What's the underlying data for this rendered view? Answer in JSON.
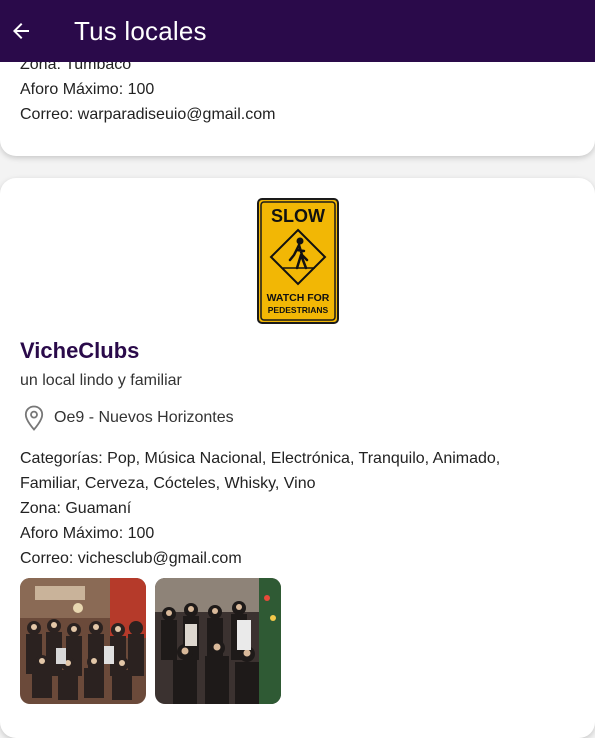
{
  "appbar": {
    "title": "Tus locales"
  },
  "previous_card": {
    "zona_line": "Zona: Tumbaco",
    "aforo_line": "Aforo Máximo: 100",
    "correo_line": "Correo: warparadiseuio@gmail.com"
  },
  "venue": {
    "logo": {
      "top_text": "SLOW",
      "bottom_text_1": "WATCH FOR",
      "bottom_text_2": "PEDESTRIANS"
    },
    "name": "VicheClubs",
    "tagline": "un local lindo y familiar",
    "location_icon": "location-pin-icon",
    "location": "Oe9 - Nuevos Horizontes",
    "categories_line_1": "Categorías: Pop, Música Nacional, Electrónica, Tranquilo, Animado,",
    "categories_line_2": "Familiar, Cerveza, Cócteles, Whisky, Vino",
    "zona_line": "Zona: Guamaní",
    "aforo_line": "Aforo Máximo: 100",
    "correo_line": "Correo: vichesclub@gmail.com"
  },
  "colors": {
    "appbar_bg": "#2a0a4a",
    "title_color": "#2a0a4a",
    "sign_yellow": "#f2b705"
  }
}
